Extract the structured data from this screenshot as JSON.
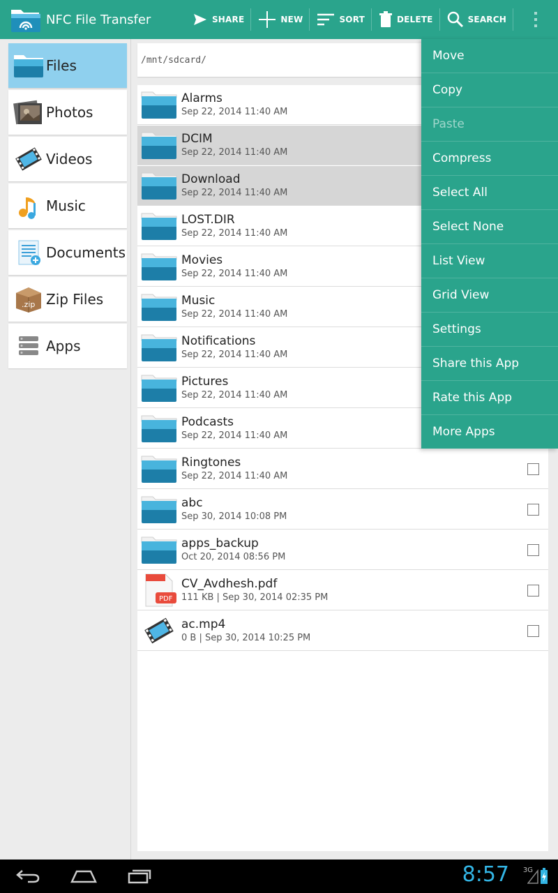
{
  "app": {
    "title": "NFC File Transfer",
    "accent_color": "#2aa48c",
    "selected_color": "#8fd0ee"
  },
  "toolbar": {
    "share_label": "SHARE",
    "new_label": "NEW",
    "sort_label": "SORT",
    "delete_label": "DELETE",
    "search_label": "SEARCH",
    "overflow_icon": "vertical-dots-icon"
  },
  "sidebar": {
    "items": [
      {
        "label": "Files",
        "icon": "folder-icon",
        "active": true
      },
      {
        "label": "Photos",
        "icon": "photos-icon",
        "active": false
      },
      {
        "label": "Videos",
        "icon": "film-icon",
        "active": false
      },
      {
        "label": "Music",
        "icon": "music-note-icon",
        "active": false
      },
      {
        "label": "Documents",
        "icon": "document-icon",
        "active": false
      },
      {
        "label": "Zip Files",
        "icon": "zip-box-icon",
        "active": false
      },
      {
        "label": "Apps",
        "icon": "apps-stack-icon",
        "active": false
      }
    ]
  },
  "path": {
    "current": "/mnt/sdcard/"
  },
  "files": [
    {
      "name": "Alarms",
      "meta": "Sep 22, 2014 11:40 AM",
      "type": "folder",
      "selected": false
    },
    {
      "name": "DCIM",
      "meta": "Sep 22, 2014 11:40 AM",
      "type": "folder",
      "selected": true
    },
    {
      "name": "Download",
      "meta": "Sep 22, 2014 11:40 AM",
      "type": "folder",
      "selected": true
    },
    {
      "name": "LOST.DIR",
      "meta": "Sep 22, 2014 11:40 AM",
      "type": "folder",
      "selected": false
    },
    {
      "name": "Movies",
      "meta": "Sep 22, 2014 11:40 AM",
      "type": "folder",
      "selected": false
    },
    {
      "name": "Music",
      "meta": "Sep 22, 2014 11:40 AM",
      "type": "folder",
      "selected": false
    },
    {
      "name": "Notifications",
      "meta": "Sep 22, 2014 11:40 AM",
      "type": "folder",
      "selected": false
    },
    {
      "name": "Pictures",
      "meta": "Sep 22, 2014 11:40 AM",
      "type": "folder",
      "selected": false
    },
    {
      "name": "Podcasts",
      "meta": "Sep 22, 2014 11:40 AM",
      "type": "folder",
      "selected": false
    },
    {
      "name": "Ringtones",
      "meta": "Sep 22, 2014 11:40 AM",
      "type": "folder",
      "selected": false
    },
    {
      "name": "abc",
      "meta": "Sep 30, 2014 10:08 PM",
      "type": "folder",
      "selected": false
    },
    {
      "name": "apps_backup",
      "meta": "Oct 20, 2014 08:56 PM",
      "type": "folder",
      "selected": false
    },
    {
      "name": "CV_Avdhesh.pdf",
      "meta": "111 KB | Sep 30, 2014 02:35 PM",
      "type": "pdf",
      "selected": false
    },
    {
      "name": "ac.mp4",
      "meta": "0 B | Sep 30, 2014 10:25 PM",
      "type": "video",
      "selected": false
    }
  ],
  "menu": {
    "items": [
      {
        "label": "Move",
        "enabled": true
      },
      {
        "label": "Copy",
        "enabled": true
      },
      {
        "label": "Paste",
        "enabled": false
      },
      {
        "label": "Compress",
        "enabled": true
      },
      {
        "label": "Select All",
        "enabled": true
      },
      {
        "label": "Select None",
        "enabled": true
      },
      {
        "label": "List View",
        "enabled": true
      },
      {
        "label": "Grid View",
        "enabled": true
      },
      {
        "label": "Settings",
        "enabled": true
      },
      {
        "label": "Share this App",
        "enabled": true
      },
      {
        "label": "Rate this App",
        "enabled": true
      },
      {
        "label": "More Apps",
        "enabled": true
      }
    ]
  },
  "pdf_badge": "PDF",
  "zip_badge": ".zip",
  "statusbar": {
    "time": "8:57",
    "network": "3G"
  }
}
